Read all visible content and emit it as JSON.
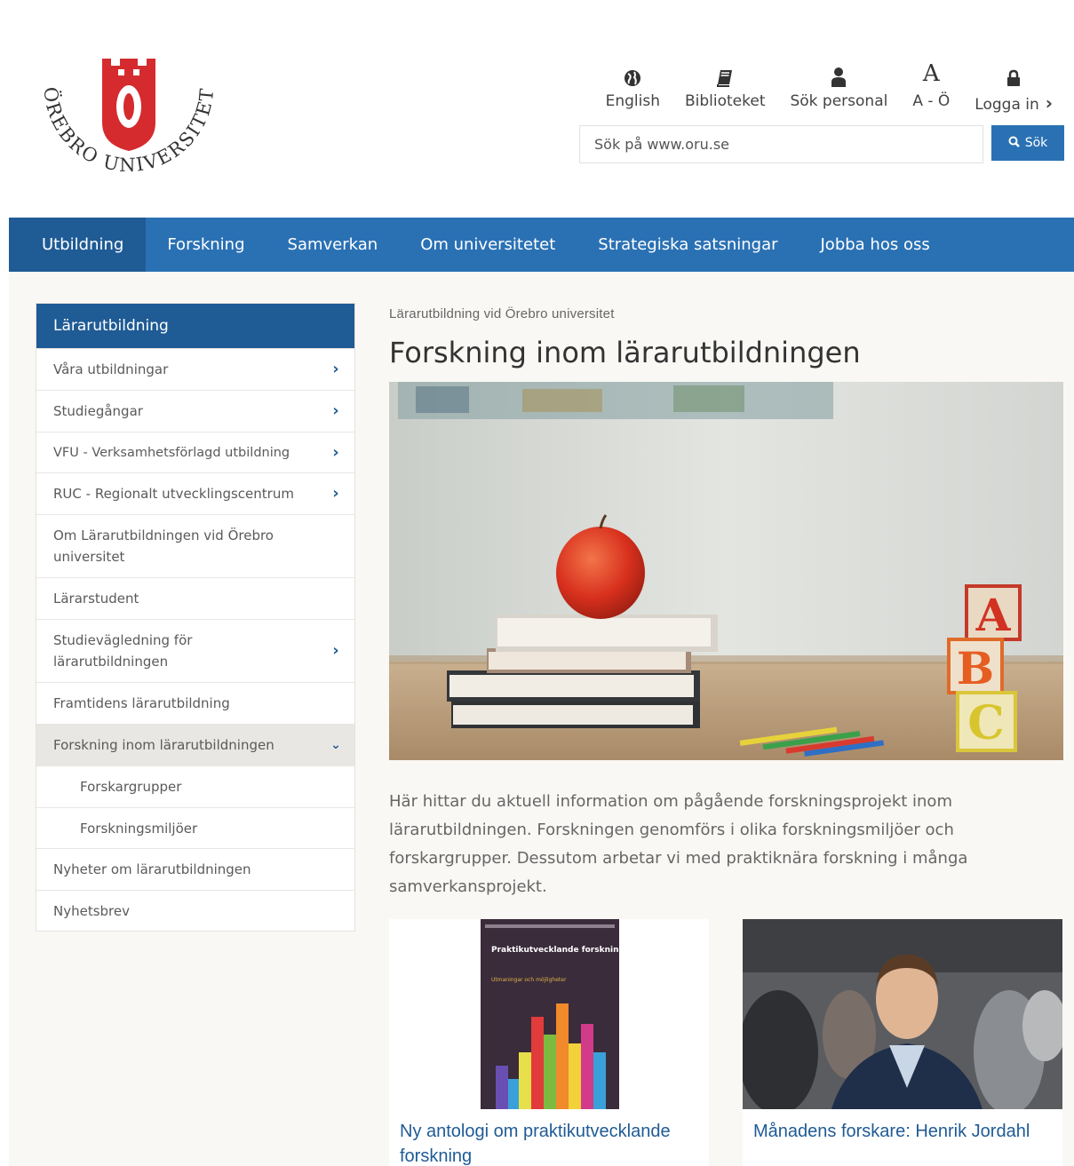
{
  "logo": {
    "letter": "Ö",
    "ring_text": "ÖREBRO UNIVERSITET"
  },
  "utility": [
    {
      "label": "English",
      "icon": "globe-icon"
    },
    {
      "label": "Biblioteket",
      "icon": "book-icon"
    },
    {
      "label": "Sök personal",
      "icon": "person-icon"
    },
    {
      "label": "A - Ö",
      "icon": "letter-a-icon"
    },
    {
      "label": "Logga in",
      "icon": "lock-icon"
    }
  ],
  "search": {
    "placeholder": "Sök på www.oru.se",
    "button_label": "Sök"
  },
  "nav": [
    {
      "label": "Utbildning",
      "active": true
    },
    {
      "label": "Forskning"
    },
    {
      "label": "Samverkan"
    },
    {
      "label": "Om universitetet"
    },
    {
      "label": "Strategiska satsningar"
    },
    {
      "label": "Jobba hos oss"
    }
  ],
  "sidebar": {
    "heading": "Lärarutbildning",
    "items": [
      {
        "label": "Våra utbildningar",
        "chevron": "right"
      },
      {
        "label": "Studiegångar",
        "chevron": "right"
      },
      {
        "label": "VFU - Verksamhetsförlagd utbildning",
        "chevron": "right"
      },
      {
        "label": "RUC - Regionalt utvecklingscentrum",
        "chevron": "right"
      },
      {
        "label": "Om Lärarutbildningen vid Örebro universitet"
      },
      {
        "label": "Lärarstudent"
      },
      {
        "label": "Studievägledning för lärarutbildningen",
        "chevron": "right"
      },
      {
        "label": "Framtidens lärarutbildning"
      },
      {
        "label": "Forskning inom lärarutbildningen",
        "chevron": "down",
        "current": true
      },
      {
        "label": "Forskargrupper",
        "sub": true
      },
      {
        "label": "Forskningsmiljöer",
        "sub": true
      },
      {
        "label": "Nyheter om lärarutbildningen"
      },
      {
        "label": "Nyhetsbrev"
      }
    ]
  },
  "main": {
    "section_label": "Lärarutbildning vid Örebro universitet",
    "title": "Forskning inom lärarutbildningen",
    "intro": "Här hittar du aktuell information om pågående forskningsprojekt inom lärarutbildningen. Forskningen genomförs i olika forskningsmiljöer och forskargrupper. Dessutom arbetar vi med praktiknära forskning i många samverkansprojekt."
  },
  "hero_blocks": [
    "A",
    "B",
    "C"
  ],
  "cards": [
    {
      "title": "Ny antologi om praktikutvecklande forskning",
      "book_cover_title": "Praktikutvecklande forskning mellan skola och akademi",
      "book_cover_subtitle": "Utmaningar och möjligheter"
    },
    {
      "title": "Månadens forskare: Henrik Jordahl"
    }
  ],
  "colors": {
    "brand_blue": "#2a71b4",
    "dark_blue": "#1f5b95",
    "logo_red": "#d52b2e"
  }
}
